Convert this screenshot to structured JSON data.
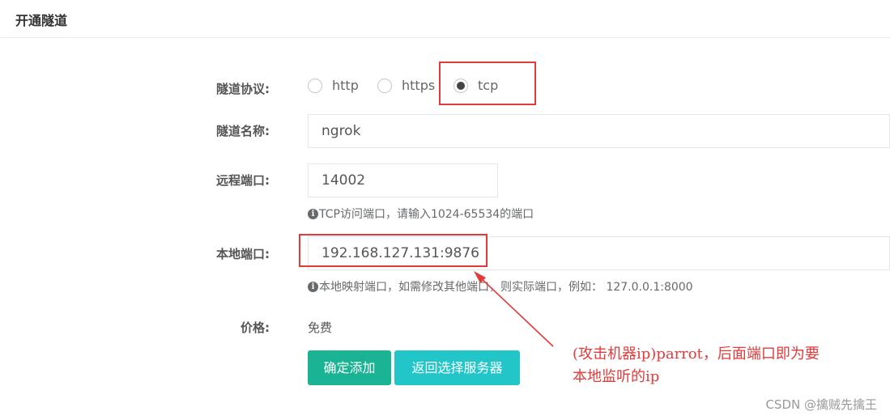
{
  "panel": {
    "title": "开通隧道"
  },
  "form": {
    "protocol": {
      "label": "隧道协议:",
      "options": [
        "http",
        "https",
        "tcp"
      ],
      "selected": "tcp"
    },
    "name": {
      "label": "隧道名称:",
      "value": "ngrok"
    },
    "remote_port": {
      "label": "远程端口:",
      "value": "14002",
      "help": "TCP访问端口，请输入1024-65534的端口"
    },
    "local_port": {
      "label": "本地端口:",
      "value": "192.168.127.131:9876",
      "help": "本地映射端口，如需修改其他端口，则实际端口，例如： 127.0.0.1:8000"
    },
    "price": {
      "label": "价格:",
      "value": "免费"
    },
    "buttons": {
      "confirm": "确定添加",
      "back": "返回选择服务器"
    }
  },
  "annotation": {
    "line1": "(攻击机器ip)parrot，后面端口即为要",
    "line2": "本地监听的ip",
    "color": "#e23b3b"
  },
  "watermark": "CSDN @擒贼先擒王",
  "colors": {
    "primary": "#1ab394",
    "info": "#23c6c8"
  }
}
